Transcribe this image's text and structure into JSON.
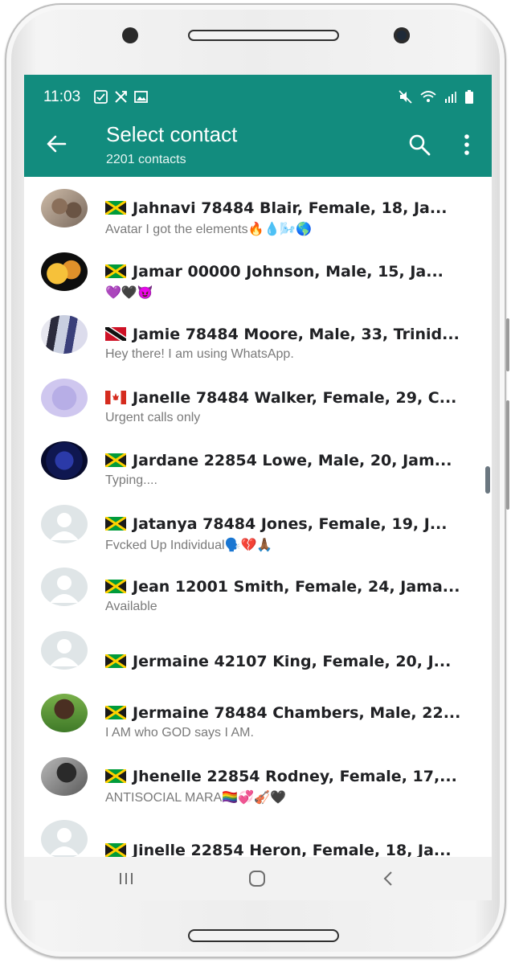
{
  "status_bar": {
    "time": "11:03"
  },
  "appbar": {
    "title": "Select contact",
    "subtitle": "2201 contacts",
    "color": "#128c7e"
  },
  "contacts": [
    {
      "name": "Jahnavi 78484 Blair, Female, 18, Ja...",
      "about": "Avatar I got the elements🔥💧🌬️🌎",
      "flag": "jamaica",
      "avatar": "photo"
    },
    {
      "name": "Jamar 00000 Johnson, Male, 15, Ja...",
      "about": "💜🖤😈",
      "flag": "jamaica",
      "avatar": "photo"
    },
    {
      "name": "Jamie 78484 Moore, Male, 33, Trinid...",
      "about": "Hey there! I am using WhatsApp.",
      "flag": "trinidad",
      "avatar": "photo"
    },
    {
      "name": "Janelle 78484 Walker, Female, 29, C...",
      "about": "Urgent calls only",
      "flag": "canada",
      "avatar": "photo"
    },
    {
      "name": "Jardane 22854 Lowe, Male, 20, Jam...",
      "about": "Typing....",
      "flag": "jamaica",
      "avatar": "photo"
    },
    {
      "name": "Jatanya 78484 Jones, Female, 19, J...",
      "about": "Fvcked Up Individual🗣️💔🙏🏾",
      "flag": "jamaica",
      "avatar": "default"
    },
    {
      "name": "Jean 12001 Smith, Female, 24, Jama...",
      "about": "Available",
      "flag": "jamaica",
      "avatar": "default"
    },
    {
      "name": "Jermaine 42107 King, Female, 20, J...",
      "about": "",
      "flag": "jamaica",
      "avatar": "default"
    },
    {
      "name": "Jermaine 78484 Chambers, Male, 22...",
      "about": "I AM who GOD says I AM.",
      "flag": "jamaica",
      "avatar": "photo"
    },
    {
      "name": "Jhenelle 22854 Rodney, Female, 17,...",
      "about": "ANTISOCIAL MARA🏳️‍🌈💞🎻🖤",
      "flag": "jamaica",
      "avatar": "photo"
    },
    {
      "name": "Jinelle 22854 Heron, Female, 18, Ja...",
      "about": "",
      "flag": "jamaica",
      "avatar": "default"
    }
  ]
}
